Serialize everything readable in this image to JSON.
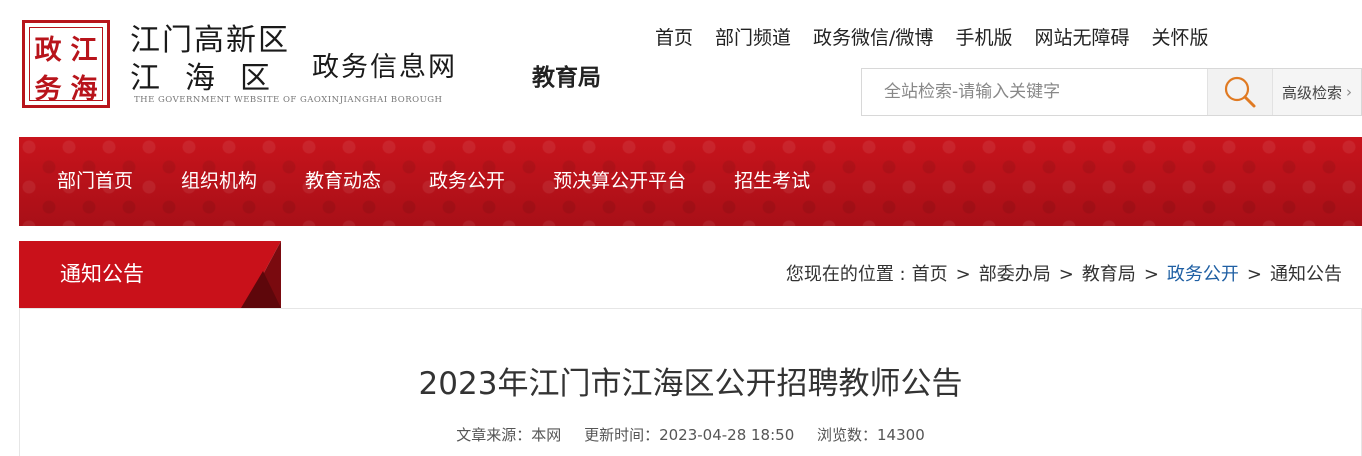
{
  "header": {
    "seal_chars": [
      "政",
      "江",
      "务",
      "海"
    ],
    "logo_line1": "江门高新区",
    "logo_line2": "江海区",
    "logo_gov": "政务信息网",
    "logo_en": "THE GOVERNMENT WEBSITE OF GAOXINJIANGHAI BOROUGH",
    "dept_name": "教育局",
    "top_links": [
      "首页",
      "部门频道",
      "政务微信/微博",
      "手机版",
      "网站无障碍",
      "关怀版"
    ],
    "search": {
      "placeholder": "全站检索-请输入关键字",
      "value": "",
      "advanced_label": "高级检索",
      "advanced_icon": "chevron-right-icon"
    }
  },
  "nav": {
    "items": [
      "部门首页",
      "组织机构",
      "教育动态",
      "政务公开",
      "预决算公开平台",
      "招生考试"
    ]
  },
  "section": {
    "title": "通知公告",
    "breadcrumb_prefix": "您现在的位置 :",
    "breadcrumb": [
      "首页",
      "部委办局",
      "教育局",
      "政务公开",
      "通知公告"
    ],
    "breadcrumb_separator": ">",
    "breadcrumb_active_index": 3
  },
  "article": {
    "title": "2023年江门市江海区公开招聘教师公告",
    "source": "文章来源：本网",
    "updated": "更新时间：2023-04-28 18:50",
    "views": "浏览数：14300"
  },
  "colors": {
    "brand_red": "#b8141b",
    "nav_red": "#b3121a",
    "link_blue": "#1f5fa3"
  }
}
